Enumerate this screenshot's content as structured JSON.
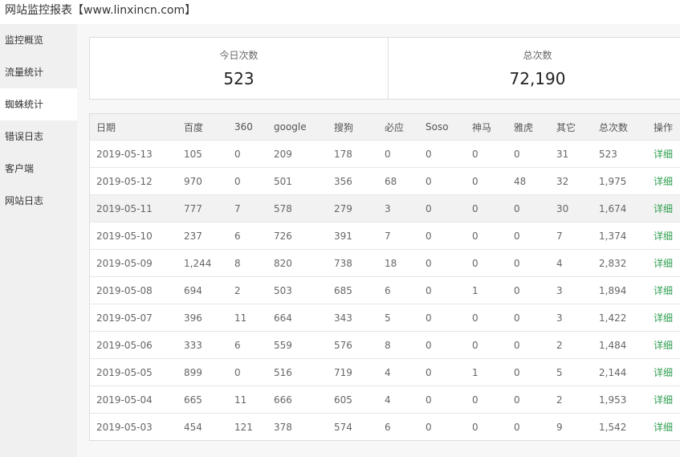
{
  "app": {
    "title": "网站监控报表【www.linxincn.com】"
  },
  "sidebar": {
    "items": [
      {
        "label": "监控概览",
        "active": false
      },
      {
        "label": "流量统计",
        "active": false
      },
      {
        "label": "蜘蛛统计",
        "active": true
      },
      {
        "label": "错误日志",
        "active": false
      },
      {
        "label": "客户端",
        "active": false
      },
      {
        "label": "网站日志",
        "active": false
      }
    ]
  },
  "stats": {
    "today": {
      "label": "今日次数",
      "value": "523"
    },
    "total": {
      "label": "总次数",
      "value": "72,190"
    }
  },
  "table": {
    "headers": [
      "日期",
      "百度",
      "360",
      "google",
      "搜狗",
      "必应",
      "Soso",
      "神马",
      "雅虎",
      "其它",
      "总次数",
      "操作"
    ],
    "rows": [
      [
        "2019-05-13",
        "105",
        "0",
        "209",
        "178",
        "0",
        "0",
        "0",
        "0",
        "31",
        "523",
        "详细"
      ],
      [
        "2019-05-12",
        "970",
        "0",
        "501",
        "356",
        "68",
        "0",
        "0",
        "48",
        "32",
        "1,975",
        "详细"
      ],
      [
        "2019-05-11",
        "777",
        "7",
        "578",
        "279",
        "3",
        "0",
        "0",
        "0",
        "30",
        "1,674",
        "详细"
      ],
      [
        "2019-05-10",
        "237",
        "6",
        "726",
        "391",
        "7",
        "0",
        "0",
        "0",
        "7",
        "1,374",
        "详细"
      ],
      [
        "2019-05-09",
        "1,244",
        "8",
        "820",
        "738",
        "18",
        "0",
        "0",
        "0",
        "4",
        "2,832",
        "详细"
      ],
      [
        "2019-05-08",
        "694",
        "2",
        "503",
        "685",
        "6",
        "0",
        "1",
        "0",
        "3",
        "1,894",
        "详细"
      ],
      [
        "2019-05-07",
        "396",
        "11",
        "664",
        "343",
        "5",
        "0",
        "0",
        "0",
        "3",
        "1,422",
        "详细"
      ],
      [
        "2019-05-06",
        "333",
        "6",
        "559",
        "576",
        "8",
        "0",
        "0",
        "0",
        "2",
        "1,484",
        "详细"
      ],
      [
        "2019-05-05",
        "899",
        "0",
        "516",
        "719",
        "4",
        "0",
        "1",
        "0",
        "5",
        "2,144",
        "详细"
      ],
      [
        "2019-05-04",
        "665",
        "11",
        "666",
        "605",
        "4",
        "0",
        "0",
        "0",
        "2",
        "1,953",
        "详细"
      ],
      [
        "2019-05-03",
        "454",
        "121",
        "378",
        "574",
        "6",
        "0",
        "0",
        "0",
        "9",
        "1,542",
        "详细"
      ]
    ],
    "highlighted_row": 2
  },
  "colors": {
    "link": "#2e9e4f",
    "sidebar_bg": "#f0f0f0",
    "header_bg": "#f2f2f2"
  }
}
